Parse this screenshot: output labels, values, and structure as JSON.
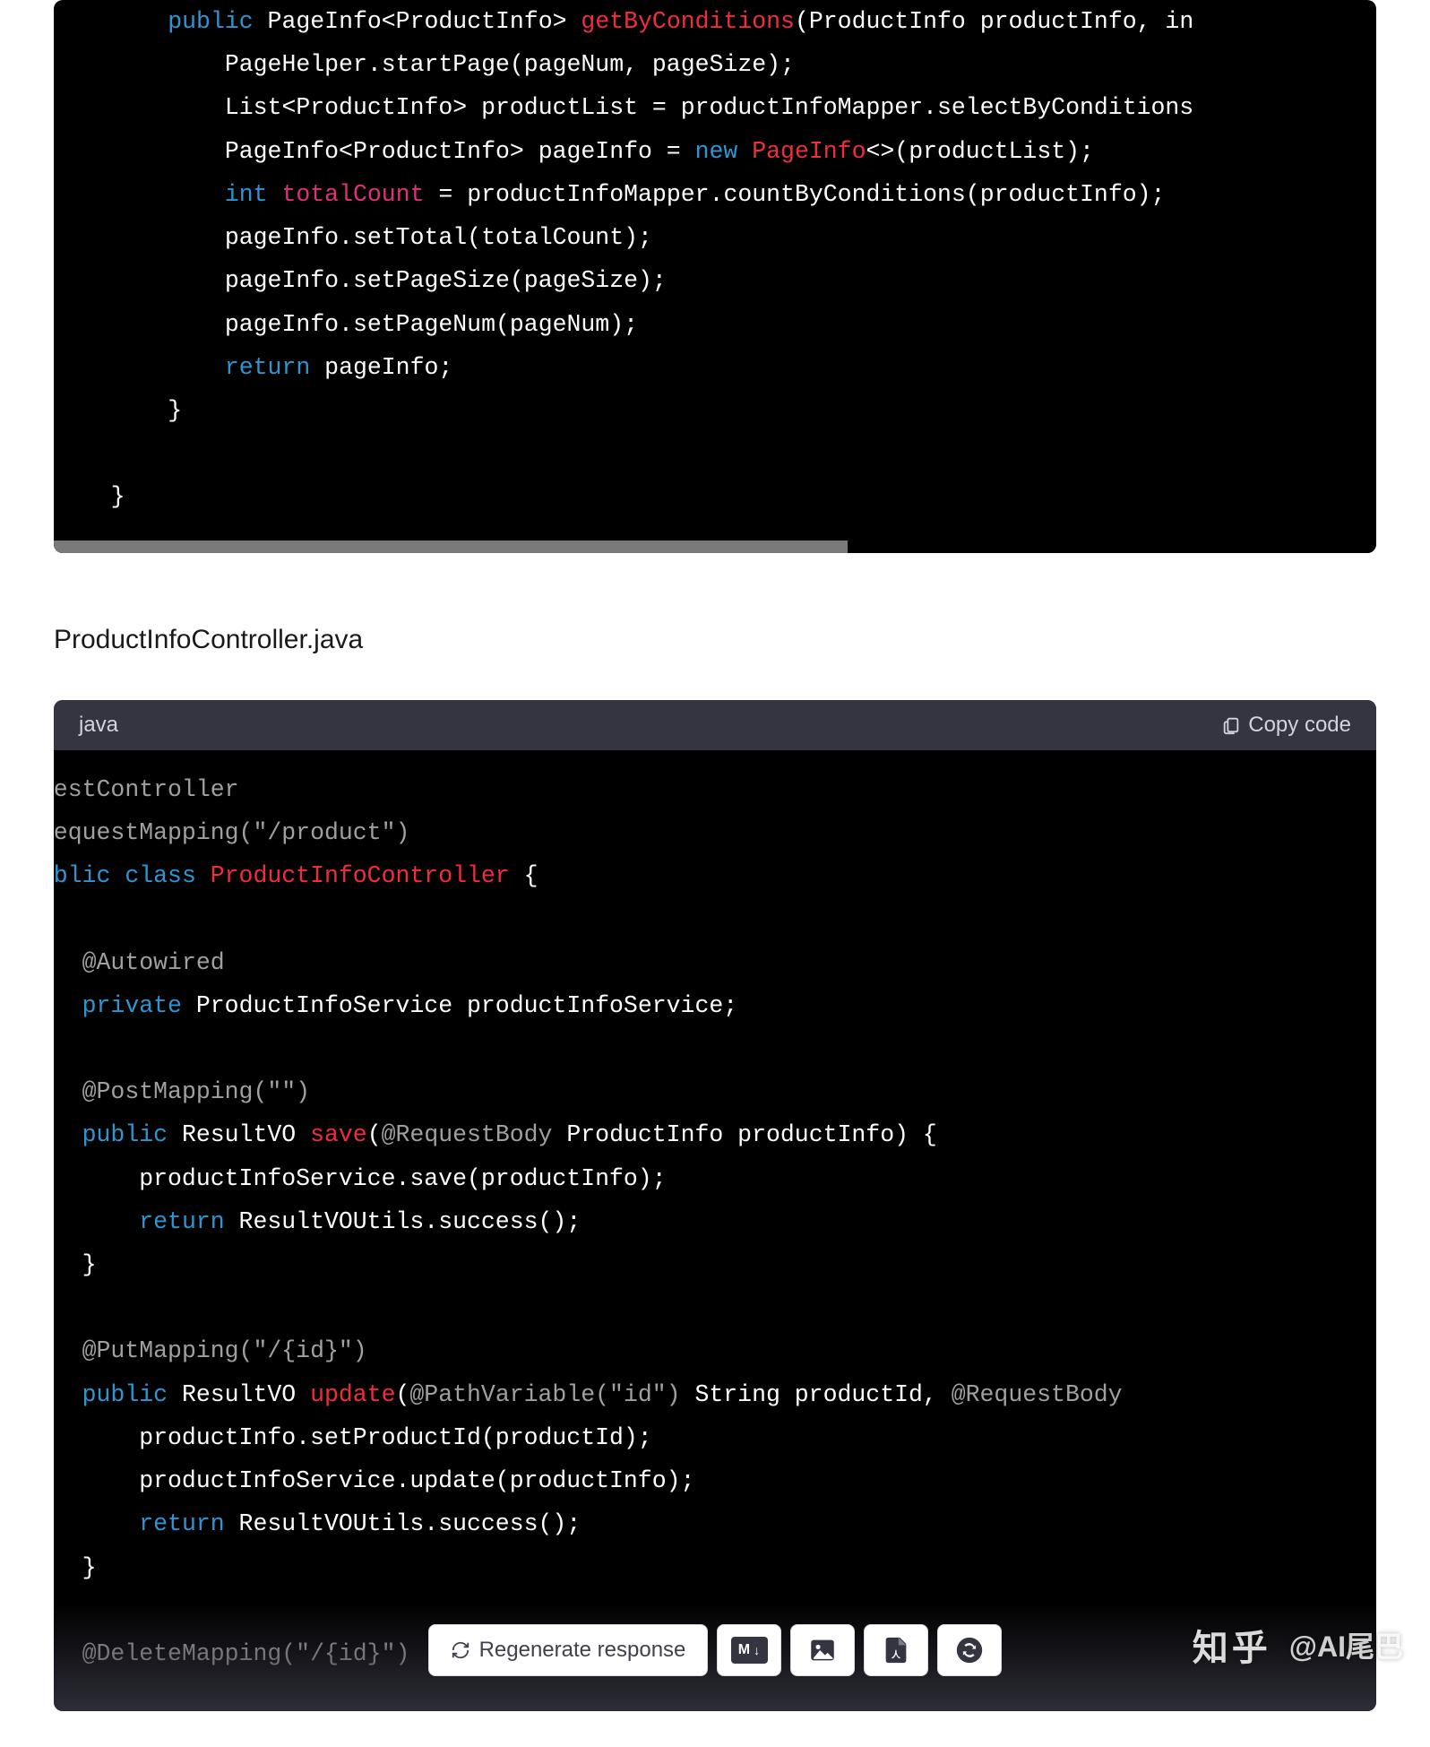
{
  "block1": {
    "tokens": {
      "public": "public",
      "sig_pre": " PageInfo<ProductInfo> ",
      "method": "getByConditions",
      "sig_post": "(ProductInfo productInfo, in",
      "l2": "            PageHelper.startPage(pageNum, pageSize);",
      "l3": "            List<ProductInfo> productList = productInfoMapper.selectByConditions",
      "l4a": "            PageInfo<ProductInfo> pageInfo = ",
      "new": "new",
      "l4b": " ",
      "pageinfo": "PageInfo",
      "l4c": "<>(productList);",
      "l5a": "            ",
      "int": "int",
      "l5b": " ",
      "totalCount": "totalCount",
      "l5c": " = productInfoMapper.countByConditions(productInfo);",
      "l6": "            pageInfo.setTotal(totalCount);",
      "l7": "            pageInfo.setPageSize(pageSize);",
      "l8": "            pageInfo.setPageNum(pageNum);",
      "l9a": "            ",
      "return": "return",
      "l9b": " pageInfo;",
      "l10": "        }",
      "l11": "",
      "l12": "    }"
    }
  },
  "file_label": "ProductInfoController.java",
  "block2": {
    "lang": "java",
    "copy": "Copy code",
    "t": {
      "a1": "@RestController",
      "a2a": "@RequestMapping(",
      "a2b": "\"/product\"",
      "a2c": ")",
      "pub": "public",
      "cls": "class",
      "name": "ProductInfoController",
      "brace": " {",
      "aw": "@Autowired",
      "priv": "private",
      "svc": " ProductInfoService productInfoService;",
      "pm1a": "@PostMapping(",
      "pm1b": "\"\"",
      "pm1c": ")",
      "m1_pre": " ResultVO ",
      "m1_name": "save",
      "m1_paren": "(",
      "m1_rb": "@RequestBody",
      "m1_post": " ProductInfo productInfo) {",
      "m1_b1": "        productInfoService.save(productInfo);",
      "ret": "return",
      "m1_b2": " ResultVOUtils.success();",
      "m1_close": "    }",
      "pm2a": "@PutMapping(",
      "pm2b": "\"/{id}\"",
      "pm2c": ")",
      "m2_pre": " ResultVO ",
      "m2_name": "update",
      "m2_paren": "(",
      "m2_pv": "@PathVariable(\"id\")",
      "m2_mid": " String productId, ",
      "m2_rb": "@RequestBody",
      "m2_post": " ",
      "m2_b1": "        productInfo.setProductId(productId);",
      "m2_b2": "        productInfoService.update(productInfo);",
      "m2_b3": " ResultVOUtils.success();",
      "m2_close": "    }",
      "dm_a": "@DeleteMapping(",
      "dm_b": "\"/{id}\"",
      "dm_c": ")"
    }
  },
  "toolbar": {
    "regenerate": "Regenerate response",
    "md": "M↓"
  },
  "watermark": {
    "zhihu": "知乎",
    "author": "@AI尾巴"
  }
}
